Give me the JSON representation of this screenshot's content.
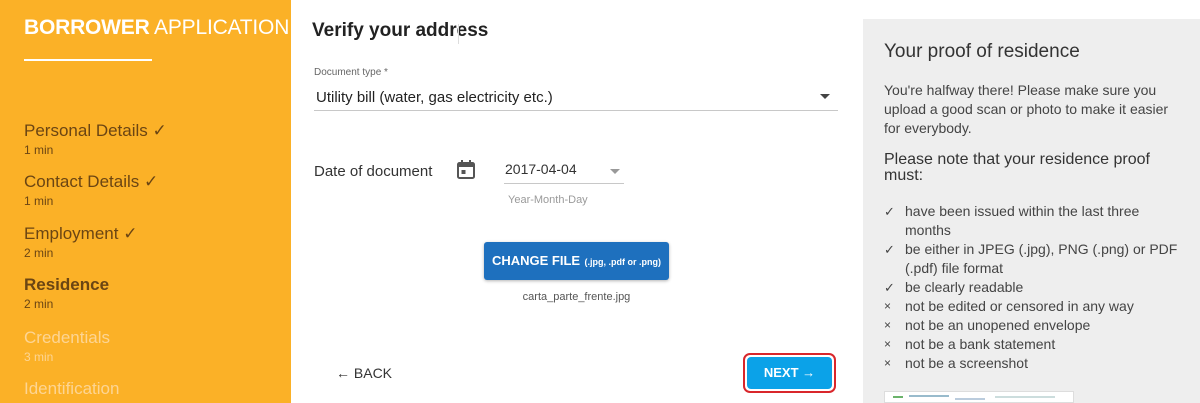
{
  "sidebar": {
    "brand_bold": "BORROWER",
    "brand_light": "APPLICATION",
    "steps": [
      {
        "label": "Personal Details ✓",
        "time": "1 min"
      },
      {
        "label": "Contact Details ✓",
        "time": "1 min"
      },
      {
        "label": "Employment ✓",
        "time": "2 min"
      },
      {
        "label": "Residence",
        "time": "2 min"
      },
      {
        "label": "Credentials",
        "time": "3 min"
      },
      {
        "label": "Identification",
        "time": ""
      }
    ]
  },
  "main": {
    "title": "Verify your address",
    "document_type": {
      "label": "Document type",
      "required_mark": "*",
      "value": "Utility bill (water, gas electricity etc.)"
    },
    "date": {
      "label": "Date of document",
      "value": "2017-04-04",
      "hint": "Year-Month-Day"
    },
    "upload": {
      "button_main": "CHANGE FILE",
      "button_sub": "(.jpg, .pdf or .png)",
      "file_name": "carta_parte_frente.jpg"
    },
    "nav": {
      "back_label": "← BACK",
      "next_label": "NEXT →"
    }
  },
  "panel": {
    "title": "Your proof of residence",
    "intro": "You're halfway there! Please make sure you upload a good scan or photo to make it easier for everybody.",
    "note": "Please note that your residence proof must:",
    "requirements": [
      {
        "mark": "✓",
        "text": "have been issued within the last three months"
      },
      {
        "mark": "✓",
        "text": "be either in JPEG (.jpg), PNG (.png) or PDF (.pdf) file format"
      },
      {
        "mark": "✓",
        "text": "be clearly readable"
      },
      {
        "mark": "×",
        "text": "not be edited or censored in any way"
      },
      {
        "mark": "×",
        "text": "not be an unopened envelope"
      },
      {
        "mark": "×",
        "text": "not be a bank statement"
      },
      {
        "mark": "×",
        "text": "not be a screenshot"
      }
    ]
  },
  "colors": {
    "sidebar_bg": "#FBB127",
    "step_done": "#6B4513",
    "step_future": "#FDD594",
    "change_file_button": "#1E70BE",
    "next_button": "#0BA2E8",
    "next_outline": "#D9262B",
    "panel_bg": "#EEEEEE"
  },
  "icons": {
    "calendar": "calendar-icon",
    "dropdown": "chevron-down-icon"
  }
}
